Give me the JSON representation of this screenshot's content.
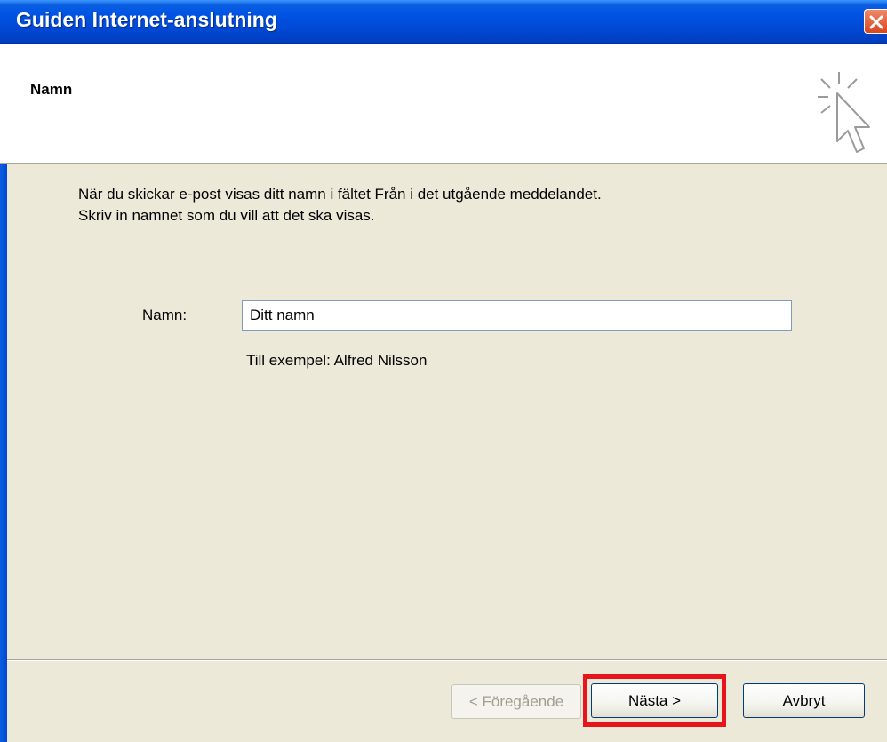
{
  "window": {
    "title": "Guiden Internet-anslutning",
    "close_icon": "close-icon"
  },
  "header": {
    "title": "Namn",
    "icon": "wizard-cursor-icon"
  },
  "content": {
    "description_line1": "När du skickar e-post visas ditt namn i fältet Från i det utgående meddelandet.",
    "description_line2": "Skriv in namnet som du vill att det ska visas.",
    "name_label": "Namn:",
    "name_value": "Ditt namn",
    "example": "Till exempel: Alfred Nilsson"
  },
  "buttons": {
    "back_label": "< Föregående",
    "next_label": "Nästa >",
    "cancel_label": "Avbryt"
  },
  "colors": {
    "titlebar": "#0055e5",
    "highlight": "#e8141b",
    "dialog_background": "#ece9d8"
  }
}
